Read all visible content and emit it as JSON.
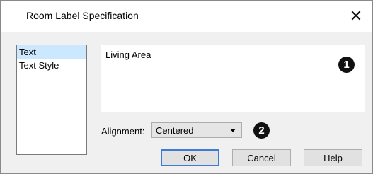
{
  "window": {
    "title": "Room Label Specification",
    "close_glyph": "✕"
  },
  "sidebar": {
    "items": [
      {
        "label": "Text",
        "selected": true
      },
      {
        "label": "Text Style",
        "selected": false
      }
    ]
  },
  "main": {
    "text_value": "Living Area",
    "alignment_label": "Alignment:",
    "alignment_value": "Centered"
  },
  "callouts": [
    "1",
    "2"
  ],
  "buttons": {
    "ok": "OK",
    "cancel": "Cancel",
    "help": "Help"
  },
  "colors": {
    "selection": "#cce8ff",
    "focus_border": "#3d7bd6"
  }
}
